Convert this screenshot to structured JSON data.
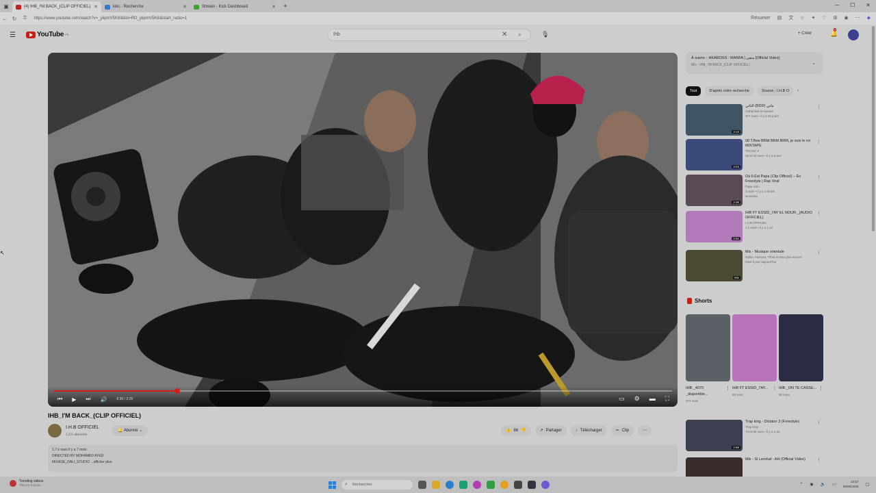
{
  "browser": {
    "tabs": [
      {
        "title": "(4) IHB_I'M BACK_(CLIP OFFICIEL)",
        "color": "#c4211a",
        "active": true
      },
      {
        "title": "kikc - Recherche",
        "color": "#3a78c9",
        "active": false
      },
      {
        "title": "Stream - Kick Dashboard",
        "color": "#3fa32f",
        "active": false
      }
    ],
    "new_tab": "+",
    "url": "https://www.youtube.com/watch?v=_ylipmV5K6I&list=RD_ylipmV5K6I&start_radio=1",
    "resume_label": "Résumer"
  },
  "youtube": {
    "logo_text": "YouTube",
    "logo_sup": "FR",
    "search_value": "Ihb",
    "create_label": "Créer",
    "notification_count": "4"
  },
  "player": {
    "time": "0:30 / 2:29",
    "progress": 0.2,
    "accent": "#d2201b"
  },
  "video": {
    "title": "IHB_I'M BACK_(CLIP OFFICIEL)",
    "channel": "I.H.B OFFICIEL",
    "subscribers": "1,3 k abonnés",
    "subscribe_label": "Abonné",
    "likes": "86",
    "share_label": "Partager",
    "download_label": "Télécharger",
    "clip_label": "Clip",
    "desc_line1": "1,7 k vues  il y a 7 mois",
    "desc_line2": "DIRECTED BY MOHAMED AYED",
    "desc_line3": "MIXAGE_DALI_STUDIO ...afficher plus"
  },
  "up_next": {
    "title": "À suivre :: AKAROSS - MANFA | منفى [Official Video]",
    "subtitle": "Mix - IHB_I'M BACK_(CLIP OFFICIEL)"
  },
  "chips": [
    "Tout",
    "D'après votre recherche",
    "Source : I.H.B O"
  ],
  "recommendations": [
    {
      "title": "الثاني (BDD) ماني",
      "channel": "mohamed al-manaei",
      "meta": "327 vues • il y a 10 jours",
      "extra": "",
      "duration": "3:13",
      "color": "#3f5566"
    },
    {
      "title": "08 T.flow BRM BRM BRM, je suis le roi MIXTAPE",
      "channel": "TFLOW ✔",
      "meta": "48 M de vues • il y a 6 ans",
      "extra": "",
      "duration": "3:03",
      "color": "#3b4a7a"
    },
    {
      "title": "Où Il Est Papa (Clip Officiel) – En Freestyle | Rap Viral",
      "channel": "Papa Solo",
      "meta": "3 vues • il y a 1 heure",
      "extra": "Nouveau",
      "duration": "2:36",
      "color": "#5a4a55"
    },
    {
      "title": "IHB FT ESSID_7AY EL NOUR _(AUDIO OFFICIEL)",
      "channel": "I.H.B OFFICIEL",
      "meta": "1 k vues • il y a 1 an",
      "extra": "",
      "duration": "2:51",
      "color": "#b07ab8"
    },
    {
      "title": "Mix - Musique orientale",
      "channel": "Kalbo, Akaross, Tflow et bien plus encore",
      "meta": "Mise à jour aujourd'hui",
      "extra": "",
      "duration": "Mix",
      "color": "#4d4a33"
    }
  ],
  "shorts": {
    "heading": "Shorts",
    "items": [
      {
        "title": "IHB _4070 _disponible...",
        "views": "373 vues",
        "color": "#5a6065"
      },
      {
        "title": "IHB FT ESSID_7AY...",
        "views": "89 vues",
        "color": "#b774b8"
      },
      {
        "title": "IHB _ON TE CASSE...",
        "views": "59 vues",
        "color": "#2a2d44"
      }
    ]
  },
  "more_recs": [
    {
      "title": "Trap king - Dictator 3 (Freestyle)",
      "channel": "Trap king",
      "meta": "74 M de vues • il y a 1 an",
      "duration": "2:59",
      "color": "#3d4050"
    },
    {
      "title": "Mix - Si Lemhaf - AH (Official Video)",
      "channel": "",
      "meta": "",
      "duration": "",
      "color": "#3a2c2c"
    }
  ],
  "taskbar": {
    "widget_title": "Trending videos",
    "widget_sub": "Tête en Kozoon",
    "search_placeholder": "Rechercher",
    "time": "22:57",
    "date": "06/06/2025",
    "icon_colors": [
      "#555",
      "#d9a92b",
      "#2a7fd0",
      "#1f9e74",
      "#b23bb0",
      "#2f9e44",
      "#e0a020",
      "#444",
      "#334",
      "#6a5acd"
    ]
  }
}
